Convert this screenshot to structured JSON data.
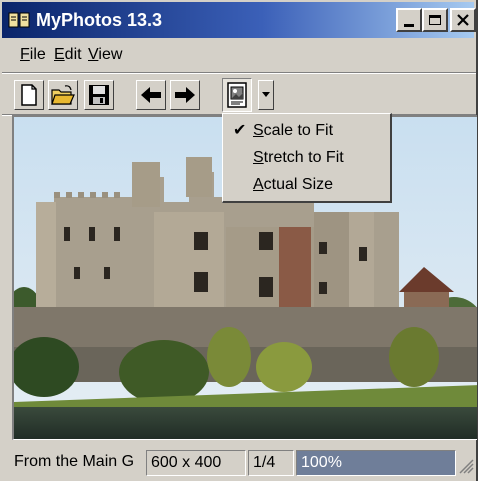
{
  "window": {
    "title": "MyPhotos 13.3"
  },
  "title_buttons": {
    "minimize_icon": "minimize-icon",
    "maximize_icon": "maximize-icon",
    "close_icon": "close-icon"
  },
  "menubar": {
    "items": [
      {
        "label": "File",
        "mnemonic": "F",
        "rest": "ile"
      },
      {
        "label": "Edit",
        "mnemonic": "E",
        "rest": "dit"
      },
      {
        "label": "View",
        "mnemonic": "V",
        "rest": "iew"
      }
    ]
  },
  "toolbar": {
    "buttons": [
      {
        "icon": "new-file-icon"
      },
      {
        "icon": "open-folder-icon"
      },
      {
        "icon": "save-disk-icon"
      },
      {
        "icon": "arrow-left-icon"
      },
      {
        "icon": "arrow-right-icon"
      },
      {
        "icon": "image-mode-icon"
      },
      {
        "icon": "dropdown-arrow-icon"
      }
    ]
  },
  "dropdown": {
    "items": [
      {
        "label": "Scale to Fit",
        "mnemonic": "S",
        "rest": "cale to Fit",
        "checked": true
      },
      {
        "label": "Stretch to Fit",
        "mnemonic": "S",
        "rest": "tretch to Fit",
        "checked": false
      },
      {
        "label": "Actual Size",
        "mnemonic": "A",
        "rest": "ctual Size",
        "checked": false
      }
    ]
  },
  "statusbar": {
    "caption": "From the Main G",
    "dimensions": "600 x 400",
    "index": "1/4",
    "zoom": "100%"
  }
}
